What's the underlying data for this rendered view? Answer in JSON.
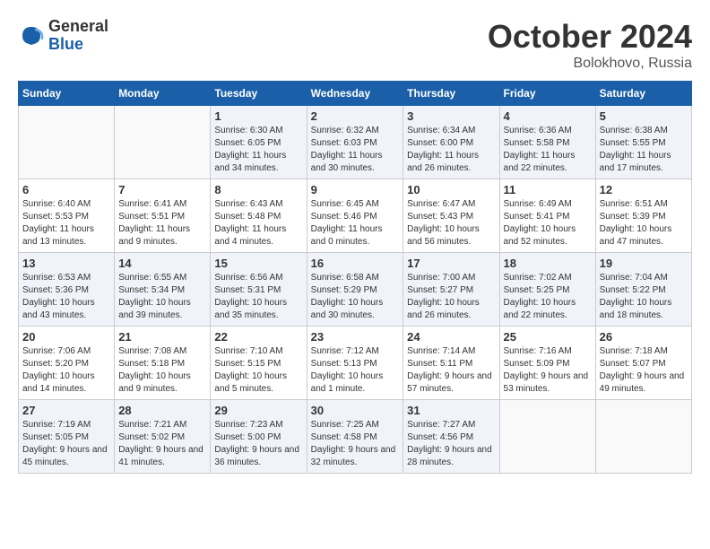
{
  "logo": {
    "general": "General",
    "blue": "Blue"
  },
  "title": "October 2024",
  "location": "Bolokhovo, Russia",
  "weekdays": [
    "Sunday",
    "Monday",
    "Tuesday",
    "Wednesday",
    "Thursday",
    "Friday",
    "Saturday"
  ],
  "weeks": [
    [
      {
        "day": "",
        "info": ""
      },
      {
        "day": "",
        "info": ""
      },
      {
        "day": "1",
        "info": "Sunrise: 6:30 AM\nSunset: 6:05 PM\nDaylight: 11 hours and 34 minutes."
      },
      {
        "day": "2",
        "info": "Sunrise: 6:32 AM\nSunset: 6:03 PM\nDaylight: 11 hours and 30 minutes."
      },
      {
        "day": "3",
        "info": "Sunrise: 6:34 AM\nSunset: 6:00 PM\nDaylight: 11 hours and 26 minutes."
      },
      {
        "day": "4",
        "info": "Sunrise: 6:36 AM\nSunset: 5:58 PM\nDaylight: 11 hours and 22 minutes."
      },
      {
        "day": "5",
        "info": "Sunrise: 6:38 AM\nSunset: 5:55 PM\nDaylight: 11 hours and 17 minutes."
      }
    ],
    [
      {
        "day": "6",
        "info": "Sunrise: 6:40 AM\nSunset: 5:53 PM\nDaylight: 11 hours and 13 minutes."
      },
      {
        "day": "7",
        "info": "Sunrise: 6:41 AM\nSunset: 5:51 PM\nDaylight: 11 hours and 9 minutes."
      },
      {
        "day": "8",
        "info": "Sunrise: 6:43 AM\nSunset: 5:48 PM\nDaylight: 11 hours and 4 minutes."
      },
      {
        "day": "9",
        "info": "Sunrise: 6:45 AM\nSunset: 5:46 PM\nDaylight: 11 hours and 0 minutes."
      },
      {
        "day": "10",
        "info": "Sunrise: 6:47 AM\nSunset: 5:43 PM\nDaylight: 10 hours and 56 minutes."
      },
      {
        "day": "11",
        "info": "Sunrise: 6:49 AM\nSunset: 5:41 PM\nDaylight: 10 hours and 52 minutes."
      },
      {
        "day": "12",
        "info": "Sunrise: 6:51 AM\nSunset: 5:39 PM\nDaylight: 10 hours and 47 minutes."
      }
    ],
    [
      {
        "day": "13",
        "info": "Sunrise: 6:53 AM\nSunset: 5:36 PM\nDaylight: 10 hours and 43 minutes."
      },
      {
        "day": "14",
        "info": "Sunrise: 6:55 AM\nSunset: 5:34 PM\nDaylight: 10 hours and 39 minutes."
      },
      {
        "day": "15",
        "info": "Sunrise: 6:56 AM\nSunset: 5:31 PM\nDaylight: 10 hours and 35 minutes."
      },
      {
        "day": "16",
        "info": "Sunrise: 6:58 AM\nSunset: 5:29 PM\nDaylight: 10 hours and 30 minutes."
      },
      {
        "day": "17",
        "info": "Sunrise: 7:00 AM\nSunset: 5:27 PM\nDaylight: 10 hours and 26 minutes."
      },
      {
        "day": "18",
        "info": "Sunrise: 7:02 AM\nSunset: 5:25 PM\nDaylight: 10 hours and 22 minutes."
      },
      {
        "day": "19",
        "info": "Sunrise: 7:04 AM\nSunset: 5:22 PM\nDaylight: 10 hours and 18 minutes."
      }
    ],
    [
      {
        "day": "20",
        "info": "Sunrise: 7:06 AM\nSunset: 5:20 PM\nDaylight: 10 hours and 14 minutes."
      },
      {
        "day": "21",
        "info": "Sunrise: 7:08 AM\nSunset: 5:18 PM\nDaylight: 10 hours and 9 minutes."
      },
      {
        "day": "22",
        "info": "Sunrise: 7:10 AM\nSunset: 5:15 PM\nDaylight: 10 hours and 5 minutes."
      },
      {
        "day": "23",
        "info": "Sunrise: 7:12 AM\nSunset: 5:13 PM\nDaylight: 10 hours and 1 minute."
      },
      {
        "day": "24",
        "info": "Sunrise: 7:14 AM\nSunset: 5:11 PM\nDaylight: 9 hours and 57 minutes."
      },
      {
        "day": "25",
        "info": "Sunrise: 7:16 AM\nSunset: 5:09 PM\nDaylight: 9 hours and 53 minutes."
      },
      {
        "day": "26",
        "info": "Sunrise: 7:18 AM\nSunset: 5:07 PM\nDaylight: 9 hours and 49 minutes."
      }
    ],
    [
      {
        "day": "27",
        "info": "Sunrise: 7:19 AM\nSunset: 5:05 PM\nDaylight: 9 hours and 45 minutes."
      },
      {
        "day": "28",
        "info": "Sunrise: 7:21 AM\nSunset: 5:02 PM\nDaylight: 9 hours and 41 minutes."
      },
      {
        "day": "29",
        "info": "Sunrise: 7:23 AM\nSunset: 5:00 PM\nDaylight: 9 hours and 36 minutes."
      },
      {
        "day": "30",
        "info": "Sunrise: 7:25 AM\nSunset: 4:58 PM\nDaylight: 9 hours and 32 minutes."
      },
      {
        "day": "31",
        "info": "Sunrise: 7:27 AM\nSunset: 4:56 PM\nDaylight: 9 hours and 28 minutes."
      },
      {
        "day": "",
        "info": ""
      },
      {
        "day": "",
        "info": ""
      }
    ]
  ]
}
